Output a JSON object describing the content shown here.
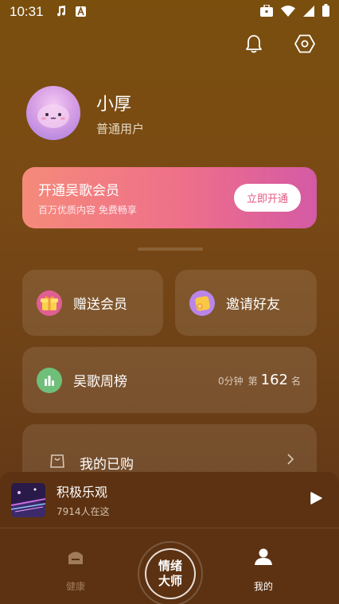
{
  "status_bar": {
    "time": "10:31"
  },
  "profile": {
    "name": "小厚",
    "level": "普通用户"
  },
  "vip": {
    "title": "开通吴歌会员",
    "subtitle": "百万优质内容 免费畅享",
    "button": "立即开通"
  },
  "actions": [
    {
      "label": "赠送会员",
      "icon": "gift-icon"
    },
    {
      "label": "邀请好友",
      "icon": "invite-icon"
    }
  ],
  "rank": {
    "label": "吴歌周榜",
    "minutes": "0分钟",
    "prefix": "第",
    "number": "162",
    "suffix": "名"
  },
  "purchase": {
    "label": "我的已购"
  },
  "player": {
    "title": "积极乐观",
    "listeners": "7914人在这"
  },
  "tabs": {
    "health": "健康",
    "center_line1": "情绪",
    "center_line2": "大师",
    "mine": "我的"
  },
  "colors": {
    "vip_start": "#f58a7a",
    "vip_end": "#d45aa5",
    "background": "#7a4f0e",
    "bar": "#5c3212"
  }
}
